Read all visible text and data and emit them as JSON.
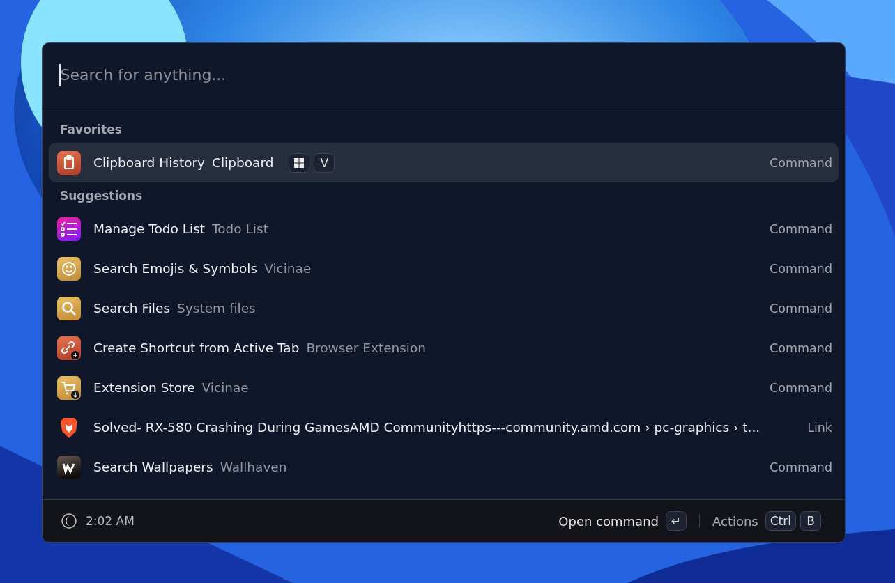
{
  "search": {
    "placeholder": "Search for anything..."
  },
  "sections": [
    {
      "title": "Favorites",
      "items": [
        {
          "title": "Clipboard History",
          "subtitle": "Clipboard",
          "type": "Command",
          "selected": true,
          "keys": [
            {
              "kind": "windows"
            },
            {
              "kind": "text",
              "label": "V"
            }
          ]
        }
      ]
    },
    {
      "title": "Suggestions",
      "items": [
        {
          "title": "Manage Todo List",
          "subtitle": "Todo List",
          "type": "Command",
          "selected": false
        },
        {
          "title": "Search Emojis & Symbols",
          "subtitle": "Vicinae",
          "type": "Command",
          "selected": false
        },
        {
          "title": "Search Files",
          "subtitle": "System files",
          "type": "Command",
          "selected": false
        },
        {
          "title": "Create Shortcut from Active Tab",
          "subtitle": "Browser Extension",
          "type": "Command",
          "selected": false
        },
        {
          "title": "Extension Store",
          "subtitle": "Vicinae",
          "type": "Command",
          "selected": false
        },
        {
          "title": "Solved- RX-580 Crashing During GamesAMD Communityhttps---community.amd.com › pc-graphics › t...",
          "type": "Link",
          "selected": false
        },
        {
          "title": "Search Wallpapers",
          "subtitle": "Wallhaven",
          "type": "Command",
          "selected": false
        }
      ]
    }
  ],
  "footer": {
    "time": "2:02 AM",
    "primary_action": {
      "label": "Open command",
      "keys": [
        "↵"
      ]
    },
    "secondary_action": {
      "label": "Actions",
      "keys": [
        "Ctrl",
        "B"
      ]
    }
  }
}
